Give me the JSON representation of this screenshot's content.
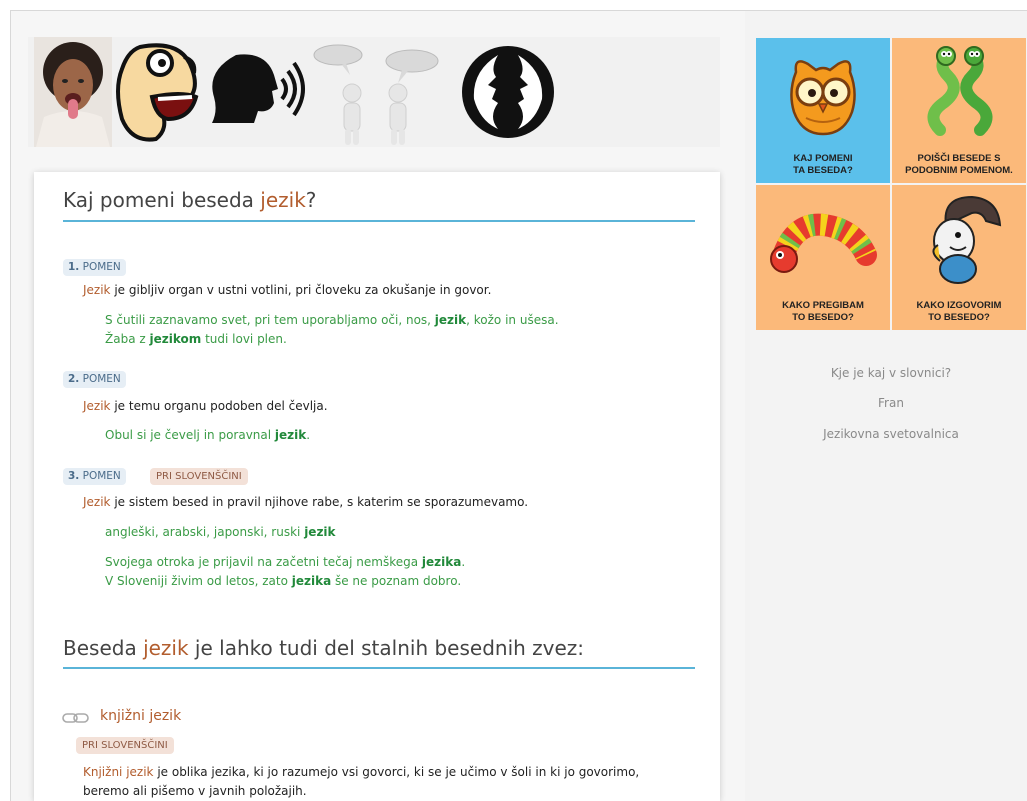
{
  "banner": {
    "images": [
      "tongue-photo",
      "cartoon-face-icon",
      "speaking-head-icon",
      "speech-bubbles-figures",
      "face-profiles-icon"
    ]
  },
  "main": {
    "heading_prefix": "Kaj pomeni beseda ",
    "heading_word": "jezik",
    "heading_suffix": "?",
    "senses": [
      {
        "number": "1.",
        "tag": "POMEN",
        "qualifier": "",
        "definition_word": "Jezik",
        "definition_rest": " je gibljiv organ v ustni votlini, pri človeku za okušanje in govor.",
        "examples": [
          {
            "parts": [
              "S čutili zaznavamo svet, pri tem uporabljamo oči, nos, ",
              "jezik",
              ", kožo in ušesa."
            ]
          },
          {
            "parts": [
              "Žaba z ",
              "jezikom",
              " tudi lovi plen."
            ]
          }
        ]
      },
      {
        "number": "2.",
        "tag": "POMEN",
        "qualifier": "",
        "definition_word": "Jezik",
        "definition_rest": " je temu organu podoben del čevlja.",
        "examples": [
          {
            "parts": [
              "Obul si je čevelj in poravnal ",
              "jezik",
              "."
            ]
          }
        ]
      },
      {
        "number": "3.",
        "tag": "POMEN",
        "qualifier": "PRI SLOVENŠČINI",
        "definition_word": "Jezik",
        "definition_rest": " je sistem besed in pravil njihove rabe, s katerim se sporazumevamo.",
        "examples": [
          {
            "parts": [
              "angleški, arabski, japonski, ruski ",
              "jezik",
              ""
            ]
          },
          {
            "parts": [
              "Svojega otroka je prijavil na začetni tečaj nemškega ",
              "jezika",
              "."
            ]
          },
          {
            "parts": [
              "V Sloveniji živim od letos, zato ",
              "jezika",
              " še ne poznam dobro."
            ]
          }
        ]
      }
    ],
    "phrases_heading_prefix": "Beseda ",
    "phrases_heading_word": "jezik",
    "phrases_heading_suffix": " je lahko tudi del stalnih besednih zvez:",
    "phrase": {
      "title": "knjižni jezik",
      "qualifier": "PRI SLOVENŠČINI",
      "definition_word": "Knjižni jezik",
      "definition_rest": " je oblika jezika, ki jo razumejo vsi govorci, ki se je učimo v šoli in ki jo govorimo,",
      "definition_line2": "beremo ali pišemo v javnih položajih."
    }
  },
  "side": {
    "tiles": [
      {
        "label": "KAJ POMENI\nTA BESEDA?",
        "color": "#5bc0eb",
        "icon": "owl-icon"
      },
      {
        "label": "POIŠČI BESEDE S\nPODOBNIM POMENOM.",
        "color": "#fbb97a",
        "icon": "snakes-icon"
      },
      {
        "label": "KAKO PREGIBAM\nTO BESEDO?",
        "color": "#fbb97a",
        "icon": "caterpillar-icon"
      },
      {
        "label": "KAKO IZGOVORIM\nTO BESEDO?",
        "color": "#fbb97a",
        "icon": "bird-icon"
      }
    ],
    "links": [
      "Kje je kaj v slovnici?",
      "Fran",
      "Jezikovna svetovalnica"
    ]
  }
}
